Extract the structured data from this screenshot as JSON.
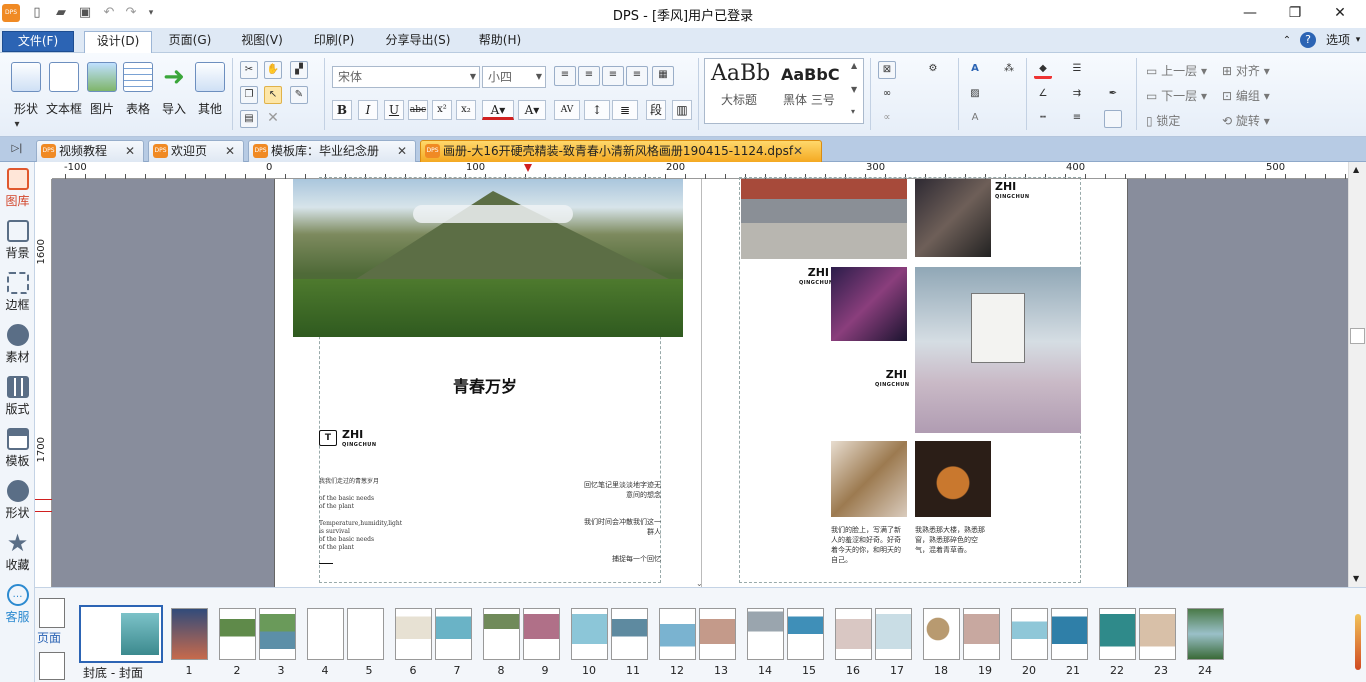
{
  "app": {
    "title": "DPS - [季风]用户已登录"
  },
  "menubar": {
    "file": "文件(F)",
    "design": "设计(D)",
    "page": "页面(G)",
    "view": "视图(V)",
    "print": "印刷(P)",
    "share": "分享导出(S)",
    "help": "帮助(H)",
    "options": "选项"
  },
  "ribbon": {
    "shape": "形状",
    "textbox": "文本框",
    "picture": "图片",
    "table": "表格",
    "import": "导入",
    "other": "其他",
    "font_family": "宋体",
    "font_size": "小四",
    "style_big": "AaBb",
    "style_big_label": "大标题",
    "style_small": "AaBbC",
    "style_small_label": "黑体 三号",
    "bring_up": "上一层",
    "send_down": "下一层",
    "lock": "锁定",
    "align": "对齐",
    "group": "编组",
    "rotate": "旋转"
  },
  "tabs": [
    {
      "label": "视频教程"
    },
    {
      "label": "欢迎页"
    },
    {
      "label": "模板库：毕业纪念册"
    },
    {
      "label": "画册-大16开硬壳精装-致青春小清新风格画册190415-1124.dpsf"
    }
  ],
  "leftbar": [
    "图库",
    "背景",
    "边框",
    "素材",
    "版式",
    "模板",
    "形状",
    "收藏",
    "客服"
  ],
  "ruler_top": [
    "-100",
    "0",
    "100",
    "200",
    "300",
    "400",
    "500"
  ],
  "ruler_left": [
    "1600",
    "1700"
  ],
  "page_left": {
    "title": "青春万岁",
    "zhi": "ZHI",
    "qingchun": "QINGCHUN",
    "line1": "我我们走过的青葱岁月",
    "line2a": "of the basic needs",
    "line2b": "of the plant",
    "line3a": "Temperature,humidity,light",
    "line3b": "is survival",
    "line3c": "of the basic needs",
    "line3d": "of the plant",
    "right1a": "回忆笔记里淡淡地字迹无",
    "right1b": "意间的想念",
    "right2a": "我们时间会冲散我们这一",
    "right2b": "群人",
    "right3": "捕捉每一个回忆"
  },
  "page_right": {
    "zhi": "ZHI",
    "qingchun": "QINGCHUN",
    "cap1": "我们的脸上，写满了新人的羞涩和好奇。好奇着今天的你，和明天的自己。",
    "cap2": "我熟悉那大楼，熟悉那窗，熟悉那碎色的空气，混着青草香。"
  },
  "bottom": {
    "page_label": "页面",
    "cover_label": "封底 - 封面",
    "pages": [
      "1",
      "2",
      "3",
      "4",
      "5",
      "6",
      "7",
      "8",
      "9",
      "10",
      "11",
      "12",
      "13",
      "14",
      "15",
      "16",
      "17",
      "18",
      "19",
      "20",
      "21",
      "22",
      "23",
      "24"
    ]
  },
  "colors": {
    "accent": "#2c64b4",
    "tab_active": "#f4a922",
    "canvas_bg": "#888d9c"
  }
}
